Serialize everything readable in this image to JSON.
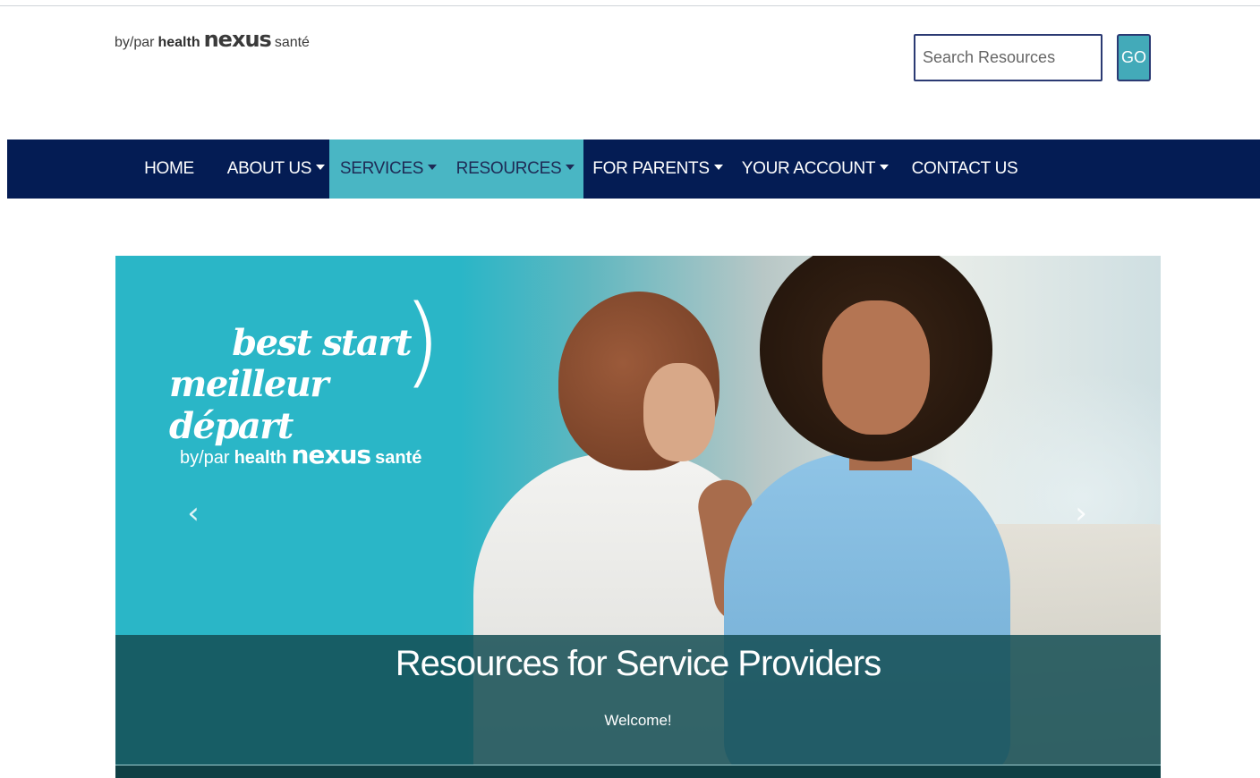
{
  "header": {
    "logo": {
      "by": "by/par",
      "health": "health",
      "nexus": "nexus",
      "sante": "santé"
    },
    "search": {
      "placeholder": "Search Resources",
      "button_label": "GO"
    }
  },
  "nav": {
    "items": [
      {
        "label": "HOME",
        "has_dropdown": false,
        "active": false
      },
      {
        "label": "ABOUT US",
        "has_dropdown": true,
        "active": false
      },
      {
        "label": "SERVICES",
        "has_dropdown": true,
        "active": true
      },
      {
        "label": "RESOURCES",
        "has_dropdown": true,
        "active": true
      },
      {
        "label": "FOR PARENTS",
        "has_dropdown": true,
        "active": false
      },
      {
        "label": "YOUR ACCOUNT",
        "has_dropdown": true,
        "active": false
      },
      {
        "label": "CONTACT US",
        "has_dropdown": false,
        "active": false
      }
    ]
  },
  "hero": {
    "logo": {
      "line1": "best start",
      "line2": "meilleur départ",
      "by": "by/par",
      "health": "health",
      "nexus": "nexus",
      "sante": "santé"
    },
    "prev_icon": "‹",
    "next_icon": "›",
    "caption_title": "Resources for Service Providers",
    "caption_subtitle": "Welcome!"
  },
  "colors": {
    "nav_bg": "#041c54",
    "nav_active": "#49b6c4",
    "go_button": "#43aab9",
    "hero_teal": "#2ab6c7"
  }
}
